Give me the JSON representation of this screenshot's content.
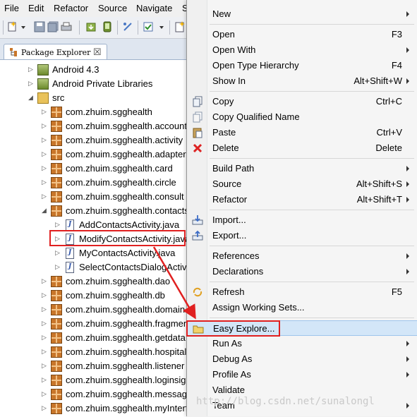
{
  "menubar": [
    "File",
    "Edit",
    "Refactor",
    "Source",
    "Navigate",
    "S"
  ],
  "view": {
    "tab_label": "Package Explorer",
    "tab_close": "☒"
  },
  "tree": [
    {
      "label": "Android 4.3",
      "icon": "android-lib-icon",
      "twist": "▷",
      "level": 1
    },
    {
      "label": "Android Private Libraries",
      "icon": "android-lib-icon",
      "twist": "▷",
      "level": 1
    },
    {
      "label": "src",
      "icon": "source-folder-icon",
      "twist": "◢",
      "level": 1
    },
    {
      "label": "com.zhuim.sgghealth",
      "icon": "package-icon",
      "twist": "▷",
      "level": 2
    },
    {
      "label": "com.zhuim.sgghealth.account",
      "icon": "package-icon",
      "twist": "▷",
      "level": 2
    },
    {
      "label": "com.zhuim.sgghealth.activity",
      "icon": "package-icon",
      "twist": "▷",
      "level": 2
    },
    {
      "label": "com.zhuim.sgghealth.adapter",
      "icon": "package-icon",
      "twist": "▷",
      "level": 2
    },
    {
      "label": "com.zhuim.sgghealth.card",
      "icon": "package-icon",
      "twist": "▷",
      "level": 2
    },
    {
      "label": "com.zhuim.sgghealth.circle",
      "icon": "package-icon",
      "twist": "▷",
      "level": 2
    },
    {
      "label": "com.zhuim.sgghealth.consult",
      "icon": "package-icon",
      "twist": "▷",
      "level": 2
    },
    {
      "label": "com.zhuim.sgghealth.contacts",
      "icon": "package-icon",
      "twist": "◢",
      "level": 2
    },
    {
      "label": "AddContactsActivity.java",
      "icon": "java-file-icon",
      "twist": "▷",
      "level": 3
    },
    {
      "label": "ModifyContactsActivity.java",
      "icon": "java-file-icon",
      "twist": "▷",
      "level": 3
    },
    {
      "label": "MyContactsActivity.java",
      "icon": "java-file-icon",
      "twist": "▷",
      "level": 3
    },
    {
      "label": "SelectContactsDialogActivity.java",
      "icon": "java-file-icon",
      "twist": "▷",
      "level": 3
    },
    {
      "label": "com.zhuim.sgghealth.dao",
      "icon": "package-icon",
      "twist": "▷",
      "level": 2
    },
    {
      "label": "com.zhuim.sgghealth.db",
      "icon": "package-icon",
      "twist": "▷",
      "level": 2
    },
    {
      "label": "com.zhuim.sgghealth.domain",
      "icon": "package-icon",
      "twist": "▷",
      "level": 2
    },
    {
      "label": "com.zhuim.sgghealth.fragment",
      "icon": "package-icon",
      "twist": "▷",
      "level": 2
    },
    {
      "label": "com.zhuim.sgghealth.getdata",
      "icon": "package-icon",
      "twist": "▷",
      "level": 2
    },
    {
      "label": "com.zhuim.sgghealth.hospital",
      "icon": "package-icon",
      "twist": "▷",
      "level": 2
    },
    {
      "label": "com.zhuim.sgghealth.listener",
      "icon": "package-icon",
      "twist": "▷",
      "level": 2
    },
    {
      "label": "com.zhuim.sgghealth.loginsign",
      "icon": "package-icon",
      "twist": "▷",
      "level": 2
    },
    {
      "label": "com.zhuim.sgghealth.message",
      "icon": "package-icon",
      "twist": "▷",
      "level": 2
    },
    {
      "label": "com.zhuim.sgghealth.myInterface",
      "icon": "package-icon",
      "twist": "▷",
      "level": 2
    }
  ],
  "context_menu": [
    {
      "label": "New",
      "shortcut": "",
      "submenu": true,
      "icon": ""
    },
    {
      "sep": true
    },
    {
      "label": "Open",
      "shortcut": "F3",
      "submenu": false,
      "icon": ""
    },
    {
      "label": "Open With",
      "shortcut": "",
      "submenu": true,
      "icon": ""
    },
    {
      "label": "Open Type Hierarchy",
      "shortcut": "F4",
      "submenu": false,
      "icon": ""
    },
    {
      "label": "Show In",
      "shortcut": "Alt+Shift+W",
      "submenu": true,
      "icon": ""
    },
    {
      "sep": true
    },
    {
      "label": "Copy",
      "shortcut": "Ctrl+C",
      "submenu": false,
      "icon": "copy-icon"
    },
    {
      "label": "Copy Qualified Name",
      "shortcut": "",
      "submenu": false,
      "icon": "copy-qualified-icon"
    },
    {
      "label": "Paste",
      "shortcut": "Ctrl+V",
      "submenu": false,
      "icon": "paste-icon"
    },
    {
      "label": "Delete",
      "shortcut": "Delete",
      "submenu": false,
      "icon": "delete-icon"
    },
    {
      "sep": true
    },
    {
      "label": "Build Path",
      "shortcut": "",
      "submenu": true,
      "icon": ""
    },
    {
      "label": "Source",
      "shortcut": "Alt+Shift+S",
      "submenu": true,
      "icon": ""
    },
    {
      "label": "Refactor",
      "shortcut": "Alt+Shift+T",
      "submenu": true,
      "icon": ""
    },
    {
      "sep": true
    },
    {
      "label": "Import...",
      "shortcut": "",
      "submenu": false,
      "icon": "import-icon"
    },
    {
      "label": "Export...",
      "shortcut": "",
      "submenu": false,
      "icon": "export-icon"
    },
    {
      "sep": true
    },
    {
      "label": "References",
      "shortcut": "",
      "submenu": true,
      "icon": ""
    },
    {
      "label": "Declarations",
      "shortcut": "",
      "submenu": true,
      "icon": ""
    },
    {
      "sep": true
    },
    {
      "label": "Refresh",
      "shortcut": "F5",
      "submenu": false,
      "icon": "refresh-icon"
    },
    {
      "label": "Assign Working Sets...",
      "shortcut": "",
      "submenu": false,
      "icon": ""
    },
    {
      "sep": true
    },
    {
      "label": "Easy Explore...",
      "shortcut": "",
      "submenu": false,
      "icon": "folder-icon",
      "highlight": true
    },
    {
      "label": "Run As",
      "shortcut": "",
      "submenu": true,
      "icon": ""
    },
    {
      "label": "Debug As",
      "shortcut": "",
      "submenu": true,
      "icon": ""
    },
    {
      "label": "Profile As",
      "shortcut": "",
      "submenu": true,
      "icon": ""
    },
    {
      "label": "Validate",
      "shortcut": "",
      "submenu": false,
      "icon": ""
    },
    {
      "label": "Team",
      "shortcut": "",
      "submenu": true,
      "icon": ""
    }
  ],
  "watermark": "http://blog.csdn.net/sunalongl",
  "colors": {
    "highlight": "#d3e6f8",
    "annotation": "#e02020",
    "package": "#c8762a"
  }
}
